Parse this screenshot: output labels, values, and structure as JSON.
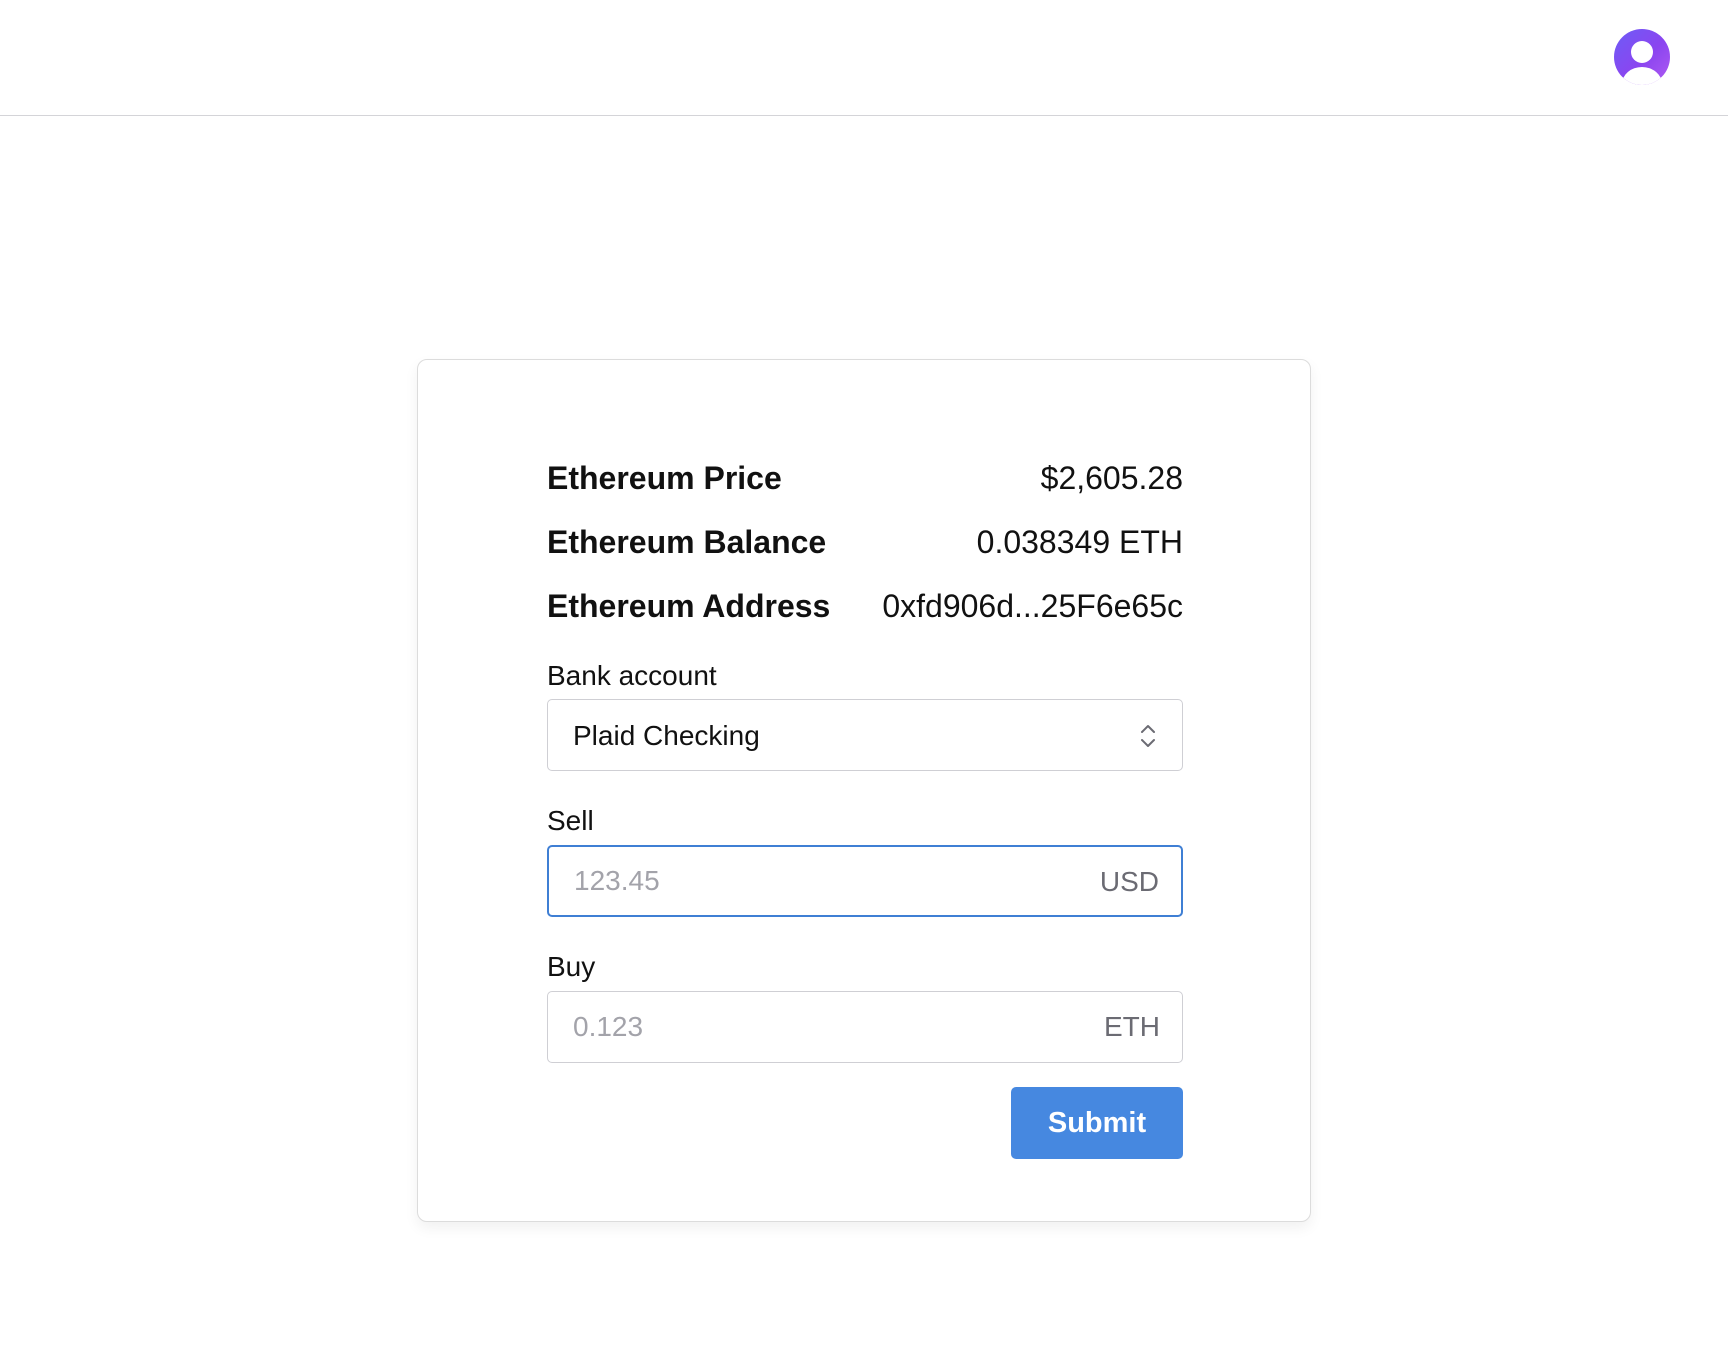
{
  "header": {
    "avatar_icon": "user-avatar-icon",
    "avatar_colors": [
      "#6d5cf6",
      "#b05bf2"
    ]
  },
  "summary": {
    "price_label": "Ethereum Price",
    "price_value": "$2,605.28",
    "balance_label": "Ethereum Balance",
    "balance_value": "0.038349 ETH",
    "address_label": "Ethereum Address",
    "address_value": "0xfd906d...25F6e65c"
  },
  "form": {
    "bank_account": {
      "label": "Bank account",
      "selected": "Plaid Checking",
      "icon": "chevron-up-down-icon"
    },
    "sell": {
      "label": "Sell",
      "placeholder": "123.45",
      "value": "",
      "unit": "USD"
    },
    "buy": {
      "label": "Buy",
      "placeholder": "0.123",
      "value": "",
      "unit": "ETH"
    },
    "submit_label": "Submit"
  },
  "colors": {
    "accent": "#4688e0",
    "focus_border": "#3f7fd4",
    "border": "#cfcfd4",
    "placeholder": "#a3a3aa"
  }
}
